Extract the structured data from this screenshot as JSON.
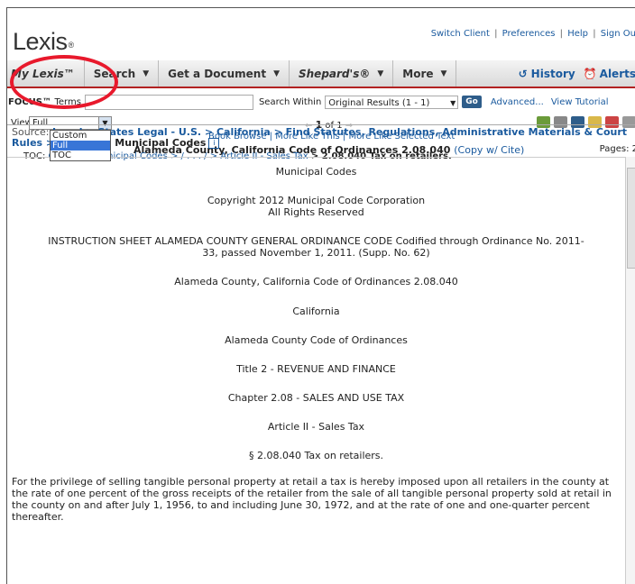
{
  "header": {
    "logo": "Lexis",
    "logo_mark": "®",
    "links": [
      "Switch Client",
      "Preferences",
      "Help",
      "Sign Ou"
    ]
  },
  "nav": {
    "my_lexis": "My Lexis™",
    "search": "Search",
    "get_document": "Get a Document",
    "shepards": "Shepard's®",
    "more": "More",
    "history": "History",
    "alerts": "Alerts"
  },
  "focus": {
    "label_bold": "FOCUS™",
    "label": "Terms",
    "search_within_label": "Search Within",
    "search_within_value": "Original Results (1 - 1)",
    "go": "Go",
    "advanced": "Advanced...",
    "view_tutorial": "View Tutorial"
  },
  "view": {
    "label": "View",
    "selected": "Full",
    "options": [
      "Custom",
      "Full",
      "TOC"
    ],
    "pager_num": "1",
    "pager_of": "of 1",
    "book_links": "Book Browse | More Like This | More Like Selected Text",
    "doc_title": "Alameda County, California Code of Ordinances 2.08.040",
    "copy_cite": "(Copy w/ Cite)",
    "pages": "Pages: 2"
  },
  "source": {
    "label": "Source:",
    "path": "Legal > States Legal - U.S. > California > Find Statutes, Regulations, Administrative Materials & Court Rules >",
    "leaf": "California Municipal Codes",
    "info_icon": "i"
  },
  "toc": {
    "label": "TOC:",
    "path": "California Municipal Codes  > / . . . /  > Article II - Sales Tax",
    "current": "> 2.08.040 Tax on retailers."
  },
  "document": {
    "lines": [
      "Municipal Codes",
      "Copyright 2012 Municipal Code Corporation",
      "All Rights Reserved",
      "INSTRUCTION SHEET ALAMEDA COUNTY GENERAL ORDINANCE CODE Codified through Ordinance No. 2011-",
      "33, passed November 1, 2011. (Supp. No. 62)",
      "Alameda County, California Code of Ordinances 2.08.040",
      "California",
      "Alameda County Code of Ordinances",
      "Title 2 - REVENUE AND FINANCE",
      "Chapter 2.08 - SALES AND USE TAX",
      "Article II - Sales Tax",
      "§ 2.08.040 Tax on retailers."
    ],
    "paragraph": "For the privilege of selling tangible personal property at retail a tax is hereby imposed upon all retailers in the county at the rate of one percent of the gross receipts of the retailer from the sale of all tangible personal property sold at retail in the county on and after July 1, 1956, to and including June 30, 1972, and at the rate of one and one-quarter percent thereafter."
  },
  "colors": {
    "link": "#1a5a9e",
    "highlight_circle": "#e8192c",
    "nav_border": "#b22222"
  }
}
